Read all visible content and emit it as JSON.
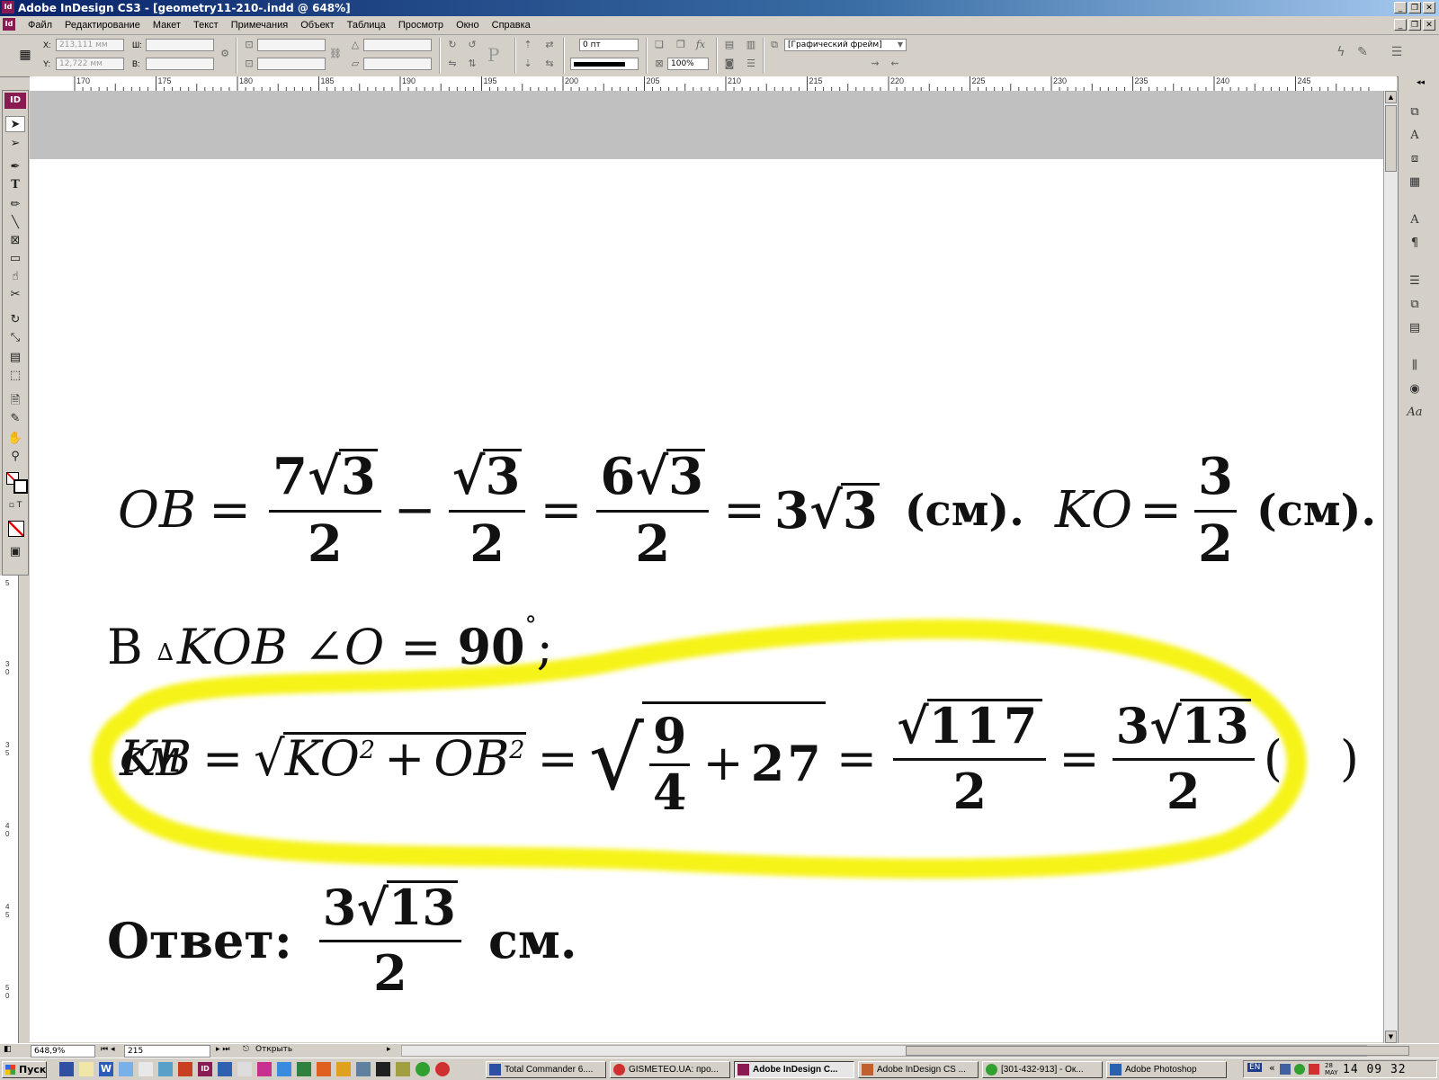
{
  "window": {
    "title": "Adobe InDesign CS3 - [geometry11-210-.indd @ 648%]",
    "app_icon": "Id",
    "controls": [
      "minimize-icon",
      "restore-icon",
      "close-icon"
    ]
  },
  "menu": [
    "Файл",
    "Редактирование",
    "Макет",
    "Текст",
    "Примечания",
    "Объект",
    "Таблица",
    "Просмотр",
    "Окно",
    "Справка"
  ],
  "control_panel": {
    "x_label": "X:",
    "x_value": "213,111 мм",
    "y_label": "Y:",
    "y_value": "12,722 мм",
    "w_label": "Ш:",
    "h_label": "В:",
    "stroke_weight": "0 пт",
    "opacity": "100%",
    "object_style": "[Графический фрейм]"
  },
  "ruler": {
    "labels": [
      "170",
      "175",
      "180",
      "185",
      "190",
      "195",
      "200",
      "205",
      "210",
      "215",
      "220",
      "225",
      "230",
      "235",
      "240",
      "245"
    ]
  },
  "vertical_ruler": {
    "labels": [
      "5",
      "3\n0",
      "3\n5",
      "4\n0",
      "4\n5",
      "5\n0"
    ]
  },
  "document": {
    "line1": {
      "lhs": "OB",
      "eq": "=",
      "f1_coef": "7",
      "f1_rad": "3",
      "f1_den": "2",
      "minus": "−",
      "f2_rad": "3",
      "f2_den": "2",
      "f3_coef": "6",
      "f3_rad": "3",
      "f3_den": "2",
      "res_coef": "3",
      "res_rad": "3",
      "unit1": "(см).",
      "lhs2": "KO",
      "f4_num": "3",
      "f4_den": "2",
      "unit2": "(см)."
    },
    "line2": {
      "prefix": "В",
      "triangle": "∆",
      "tri": "KOB",
      "angle": "∠",
      "vertex": "O",
      "eq": "=",
      "value": "90",
      "deg": "°",
      "end": ";"
    },
    "line3": {
      "overlap_text": "см",
      "lhs": "KB",
      "eq": "=",
      "term1": "KO",
      "exp": "2",
      "plus": "+",
      "term2": "OB",
      "f_num": "9",
      "f_den": "4",
      "plus2": "+",
      "c27": "27",
      "rad117": "117",
      "den117": "2",
      "coef": "3",
      "rad13": "13",
      "den13": "2",
      "open": "(",
      "close": ")"
    },
    "answer": {
      "label": "Ответ:",
      "coef": "3",
      "rad": "13",
      "den": "2",
      "unit": "см."
    }
  },
  "highlight": {
    "color": "#f5f200"
  },
  "statusbar": {
    "zoom": "648,9%",
    "page": "215",
    "status": "Открыть"
  },
  "taskbar": {
    "start": "Пуск",
    "buttons": [
      {
        "label": "Total Commander 6....",
        "icon": "floppy-icon"
      },
      {
        "label": "GISMETEO.UA: про...",
        "icon": "opera-icon"
      },
      {
        "label": "Adobe InDesign C...",
        "icon": "indesign-icon",
        "active": true
      },
      {
        "label": "Adobe InDesign CS ...",
        "icon": "feather-icon"
      },
      {
        "label": "[301-432-913] - Ок...",
        "icon": "icq-icon"
      },
      {
        "label": "Adobe Photoshop",
        "icon": "photoshop-icon"
      }
    ],
    "lang": "EN",
    "date": "28 MAY",
    "time": "14 09 32"
  }
}
